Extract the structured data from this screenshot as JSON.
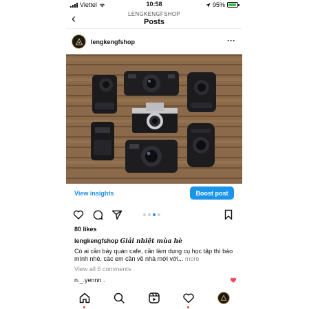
{
  "status_bar": {
    "carrier": "Viettel",
    "time": "10:58",
    "battery": "95%",
    "battery_level": 0.95
  },
  "navbar": {
    "back_glyph": "‹",
    "subtitle": "LENGKENGFSHOP",
    "title": "Posts"
  },
  "post": {
    "username": "lengkengfshop",
    "more_glyph": "···",
    "view_insights": "View insights",
    "boost_post": "Boost post",
    "carousel": {
      "count": 4,
      "active_index": 2
    },
    "likes": "80 likes",
    "caption_username": "lengkengfshop",
    "caption_tagline": "Giải nhiệt mùa hè",
    "caption_text": "Có ai cần bày quán cafe, cần làm dụng cụ học tập thì báo mình nhé. các em cần về nhà mới với...",
    "caption_more": "more",
    "view_comments": "View all 6 comments",
    "comment_user": "n._.yennn .",
    "colors": {
      "accent": "#1a95ea",
      "like_heart": "#ed4956"
    }
  },
  "tabbar": {
    "items": [
      "home-icon",
      "search-icon",
      "reels-icon",
      "activity-icon",
      "profile-avatar"
    ]
  }
}
